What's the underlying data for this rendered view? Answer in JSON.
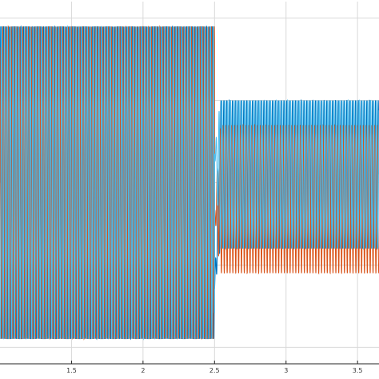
{
  "chart_data": {
    "type": "line",
    "title": "",
    "xlabel": "",
    "ylabel": "",
    "xlim": [
      1.0,
      3.65
    ],
    "ylim": [
      -1.1,
      1.1
    ],
    "grid": true,
    "x_ticks": [
      1.5,
      2,
      2.5,
      3,
      3.5
    ],
    "x_tick_labels": [
      "1.5",
      "2",
      "2.5",
      "3",
      "3.5"
    ],
    "y_grid_values": [
      -1.0,
      -0.5,
      0.0,
      0.5,
      1.0
    ],
    "series": [
      {
        "color": "#0072BD",
        "frequency": 50,
        "phase_deg": 0,
        "segments": [
          {
            "x_start": 1.0,
            "x_end": 2.5,
            "amplitude": 0.95
          },
          {
            "x_start": 2.5,
            "x_end": 3.65,
            "amplitude": 0.45,
            "offset": 0.05
          }
        ]
      },
      {
        "color": "#D95319",
        "frequency": 50,
        "phase_deg": 120,
        "segments": [
          {
            "x_start": 1.0,
            "x_end": 2.5,
            "amplitude": 0.95
          },
          {
            "x_start": 2.5,
            "x_end": 3.65,
            "amplitude": 0.45,
            "offset": -0.1
          }
        ]
      },
      {
        "color": "#4DBEEE",
        "frequency": 50,
        "phase_deg": 240,
        "segments": [
          {
            "x_start": 1.0,
            "x_end": 2.5,
            "amplitude": 0.95
          },
          {
            "x_start": 2.5,
            "x_end": 3.65,
            "amplitude": 0.45,
            "offset": 0.05
          }
        ]
      }
    ],
    "transient": {
      "x": 2.5,
      "spike_max": 0.6,
      "spike_min": -0.65
    }
  }
}
